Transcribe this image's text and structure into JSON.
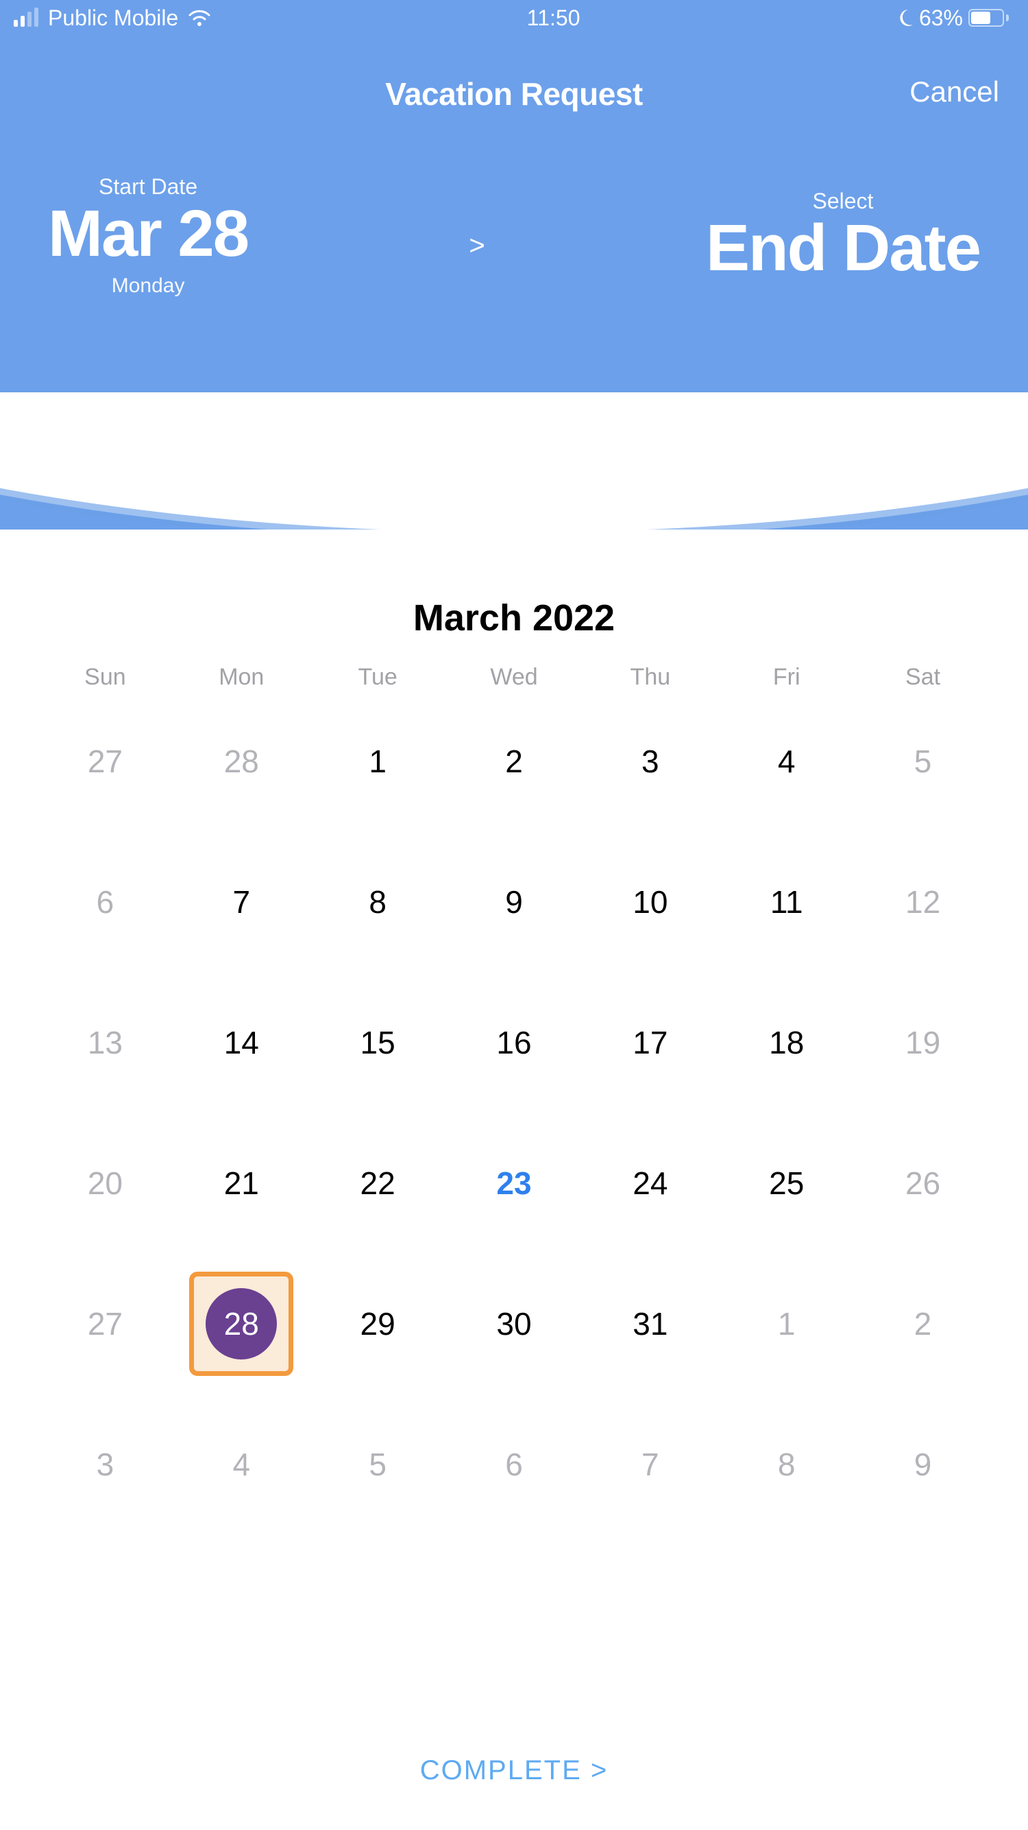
{
  "status_bar": {
    "carrier": "Public Mobile",
    "time": "11:50",
    "battery_percent": "63%"
  },
  "header": {
    "title": "Vacation Request",
    "cancel_label": "Cancel",
    "start": {
      "label": "Start Date",
      "date": "Mar 28",
      "weekday": "Monday"
    },
    "end": {
      "label": "Select",
      "date": "End Date"
    },
    "separator": ">"
  },
  "calendar": {
    "month_title": "March 2022",
    "weekdays": [
      "Sun",
      "Mon",
      "Tue",
      "Wed",
      "Thu",
      "Fri",
      "Sat"
    ],
    "weeks": [
      [
        {
          "n": "27",
          "muted": true
        },
        {
          "n": "28",
          "muted": true
        },
        {
          "n": "1"
        },
        {
          "n": "2"
        },
        {
          "n": "3"
        },
        {
          "n": "4"
        },
        {
          "n": "5",
          "muted": true
        }
      ],
      [
        {
          "n": "6",
          "muted": true
        },
        {
          "n": "7"
        },
        {
          "n": "8"
        },
        {
          "n": "9"
        },
        {
          "n": "10"
        },
        {
          "n": "11"
        },
        {
          "n": "12",
          "muted": true
        }
      ],
      [
        {
          "n": "13",
          "muted": true
        },
        {
          "n": "14"
        },
        {
          "n": "15"
        },
        {
          "n": "16"
        },
        {
          "n": "17"
        },
        {
          "n": "18"
        },
        {
          "n": "19",
          "muted": true
        }
      ],
      [
        {
          "n": "20",
          "muted": true
        },
        {
          "n": "21"
        },
        {
          "n": "22"
        },
        {
          "n": "23",
          "today": true
        },
        {
          "n": "24"
        },
        {
          "n": "25"
        },
        {
          "n": "26",
          "muted": true
        }
      ],
      [
        {
          "n": "27",
          "muted": true
        },
        {
          "n": "28",
          "selected": true
        },
        {
          "n": "29"
        },
        {
          "n": "30"
        },
        {
          "n": "31"
        },
        {
          "n": "1",
          "muted": true
        },
        {
          "n": "2",
          "muted": true
        }
      ],
      [
        {
          "n": "3",
          "muted": true
        },
        {
          "n": "4",
          "muted": true
        },
        {
          "n": "5",
          "muted": true
        },
        {
          "n": "6",
          "muted": true
        },
        {
          "n": "7",
          "muted": true
        },
        {
          "n": "8",
          "muted": true
        },
        {
          "n": "9",
          "muted": true
        }
      ]
    ]
  },
  "footer": {
    "complete_label": "COMPLETE >"
  }
}
